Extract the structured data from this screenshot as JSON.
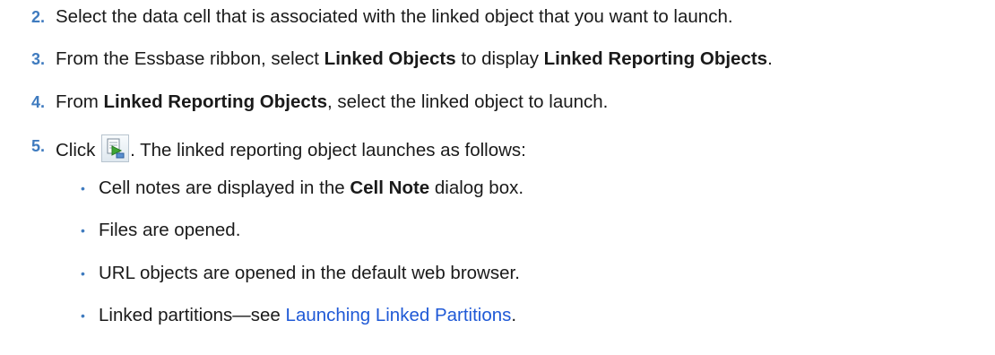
{
  "steps": [
    {
      "number": "2.",
      "text": "Select the data cell that is associated with the linked object that you want to launch."
    },
    {
      "number": "3.",
      "pre": "From the Essbase ribbon, select ",
      "bold1": "Linked Objects",
      "mid": " to display ",
      "bold2": "Linked Reporting Objects",
      "post": "."
    },
    {
      "number": "4.",
      "pre": "From ",
      "bold1": "Linked Reporting Objects",
      "post": ", select the linked object to launch."
    },
    {
      "number": "5.",
      "pre": "Click ",
      "icon": "launch-linked-object-icon",
      "post": ". The linked reporting object launches as follows:"
    }
  ],
  "bullets": [
    {
      "pre": "Cell notes are displayed in the ",
      "bold": "Cell Note",
      "post": " dialog box."
    },
    {
      "text": "Files are opened."
    },
    {
      "text": "URL objects are opened in the default web browser."
    },
    {
      "pre": "Linked partitions—see ",
      "link": "Launching Linked Partitions",
      "post": "."
    }
  ],
  "colors": {
    "number": "#3f7bbf",
    "link": "#1f59d6",
    "text": "#1a1a1a"
  }
}
